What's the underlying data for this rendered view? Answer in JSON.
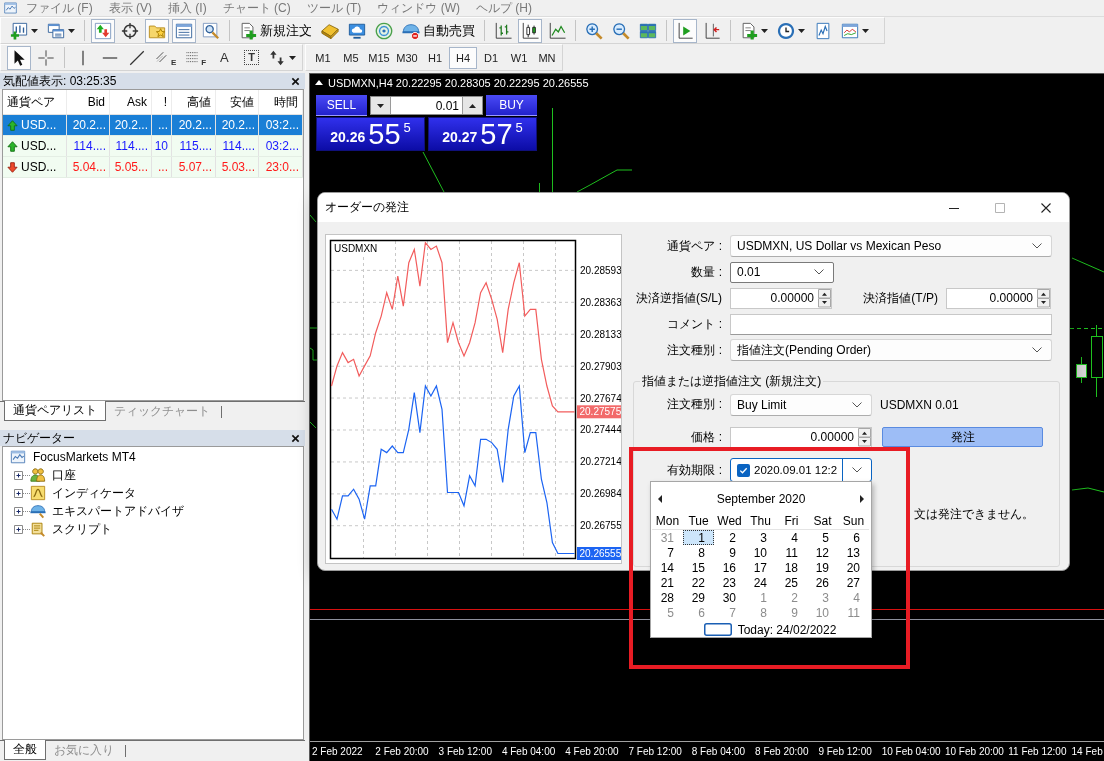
{
  "menu_bar": {
    "items": [
      "ファイル (F)",
      "表示 (V)",
      "挿入 (I)",
      "チャート (C)",
      "ツール (T)",
      "ウィンドウ (W)",
      "ヘルプ (H)"
    ]
  },
  "standard_toolbar": {
    "groups": [
      [
        {
          "kind": "new-chart",
          "pressed": false,
          "dropdown": true
        },
        {
          "kind": "profiles",
          "pressed": false,
          "dropdown": true
        }
      ],
      [
        {
          "kind": "market-watch",
          "pressed": true,
          "dropdown": false
        },
        {
          "kind": "data-window",
          "pressed": false,
          "dropdown": false
        },
        {
          "kind": "navigator",
          "pressed": true,
          "dropdown": false
        },
        {
          "kind": "terminal",
          "pressed": true,
          "dropdown": false
        },
        {
          "kind": "tester",
          "pressed": false,
          "dropdown": false
        }
      ],
      [
        {
          "kind": "new-order",
          "label": "新規注文",
          "pressed": false,
          "dropdown": false
        },
        {
          "kind": "editor",
          "pressed": false,
          "dropdown": false
        },
        {
          "kind": "cloud",
          "pressed": false,
          "dropdown": false
        },
        {
          "kind": "signals",
          "pressed": false,
          "dropdown": false
        },
        {
          "kind": "auto-trading",
          "label": "自動売買",
          "pressed": false,
          "dropdown": false
        }
      ],
      [
        {
          "kind": "bar-chart",
          "pressed": false,
          "dropdown": false
        },
        {
          "kind": "candle-chart",
          "pressed": true,
          "dropdown": false
        },
        {
          "kind": "line-chart",
          "pressed": false,
          "dropdown": false
        }
      ],
      [
        {
          "kind": "zoom-in",
          "pressed": false,
          "dropdown": false
        },
        {
          "kind": "zoom-out",
          "pressed": false,
          "dropdown": false
        },
        {
          "kind": "tile-windows",
          "pressed": false,
          "dropdown": false
        }
      ],
      [
        {
          "kind": "auto-scroll",
          "pressed": true,
          "dropdown": false
        },
        {
          "kind": "chart-shift",
          "pressed": false,
          "dropdown": false
        }
      ],
      [
        {
          "kind": "indicators",
          "pressed": false,
          "dropdown": true
        },
        {
          "kind": "periods",
          "pressed": false,
          "dropdown": true
        },
        {
          "kind": "templates",
          "pressed": false,
          "dropdown": false
        },
        {
          "kind": "template-list",
          "pressed": false,
          "dropdown": true
        }
      ]
    ]
  },
  "drawing_toolbar": {
    "groups": [
      [
        {
          "kind": "cursor",
          "pressed": true,
          "dropdown": false
        },
        {
          "kind": "crosshair",
          "pressed": false,
          "dropdown": false
        }
      ],
      [
        {
          "kind": "vertical-line",
          "pressed": false,
          "dropdown": false
        },
        {
          "kind": "horizontal-line",
          "pressed": false,
          "dropdown": false
        },
        {
          "kind": "trend-line",
          "pressed": false,
          "dropdown": false
        },
        {
          "kind": "channel",
          "glyph": "E",
          "pressed": false,
          "dropdown": false
        },
        {
          "kind": "fibonacci",
          "glyph": "F",
          "pressed": false,
          "dropdown": false
        },
        {
          "kind": "text",
          "glyph": "A",
          "pressed": false,
          "dropdown": false
        },
        {
          "kind": "text-label",
          "glyph": "T",
          "pressed": false,
          "dropdown": false
        },
        {
          "kind": "arrows",
          "pressed": false,
          "dropdown": true
        }
      ]
    ]
  },
  "timeframes": [
    {
      "label": "M1",
      "selected": false
    },
    {
      "label": "M5",
      "selected": false
    },
    {
      "label": "M15",
      "selected": false
    },
    {
      "label": "M30",
      "selected": false
    },
    {
      "label": "H1",
      "selected": false
    },
    {
      "label": "H4",
      "selected": true
    },
    {
      "label": "D1",
      "selected": false
    },
    {
      "label": "W1",
      "selected": false
    },
    {
      "label": "MN",
      "selected": false
    }
  ],
  "market_watch": {
    "title": "気配値表示: 03:25:35",
    "columns": [
      "通貨ペア",
      "Bid",
      "Ask",
      "!",
      "高値",
      "安値",
      "時間"
    ],
    "rows": [
      {
        "kind": "up",
        "selected": true,
        "cells": [
          "USD...",
          "20.2...",
          "20.2...",
          "...",
          "20.2...",
          "20.2...",
          "03:2..."
        ]
      },
      {
        "kind": "up",
        "selected": false,
        "cells": [
          "USD...",
          "114....",
          "114....",
          "10",
          "115....",
          "114....",
          "03:2..."
        ]
      },
      {
        "kind": "down",
        "selected": false,
        "cells": [
          "USD...",
          "5.04...",
          "5.05...",
          "...",
          "5.07...",
          "5.03...",
          "23:0..."
        ]
      }
    ],
    "tabs": [
      {
        "label": "通貨ペアリスト",
        "selected": true
      },
      {
        "label": "ティックチャート",
        "selected": false
      }
    ]
  },
  "navigator": {
    "title": "ナビゲーター",
    "root": {
      "label": "FocusMarkets MT4",
      "children": [
        {
          "kind": "accounts",
          "label": "口座",
          "expanded": false
        },
        {
          "kind": "indicators",
          "label": "インディケータ",
          "expanded": false
        },
        {
          "kind": "experts",
          "label": "エキスパートアドバイザ",
          "expanded": false
        },
        {
          "kind": "scripts",
          "label": "スクリプト",
          "expanded": false
        }
      ]
    },
    "tabs": [
      {
        "label": "全般",
        "selected": true
      },
      {
        "label": "お気に入り",
        "selected": false
      }
    ]
  },
  "chart": {
    "title": "USDMXN,H4 20.22295 20.28305 20.22295 20.26555",
    "one_click": {
      "sell": "SELL",
      "buy": "BUY",
      "lot": "0.01",
      "sell_price": [
        "20.26",
        "55",
        "5"
      ],
      "buy_price": [
        "20.27",
        "57",
        "5"
      ]
    },
    "time_axis": [
      "2 Feb 2022",
      "2 Feb 20:00",
      "3 Feb 12:00",
      "4 Feb 04:00",
      "4 Feb 20:00",
      "7 Feb 12:00",
      "8 Feb 04:00",
      "8 Feb 20:00",
      "9 Feb 12:00",
      "10 Feb 04:00",
      "10 Feb 20:00",
      "11 Feb 12:00",
      "14 Feb"
    ]
  },
  "order_dialog": {
    "title": "オーダーの発注",
    "chart": {
      "chart_data": {
        "type": "line",
        "title": "USDMXN",
        "grid": true,
        "ylim": [
          20.26519,
          20.28808
        ],
        "yticks": [
          20.28593,
          20.28363,
          20.28133,
          20.27903,
          20.27674,
          20.27444,
          20.27214,
          20.26984,
          20.26755
        ],
        "series": [
          {
            "color": "#f25c5c",
            "values": [
              20.27761,
              20.27905,
              20.28001,
              20.27929,
              20.27953,
              20.27833,
              20.27905,
              20.27977,
              20.28144,
              20.28264,
              20.28432,
              20.28312,
              20.28552,
              20.28336,
              20.28648,
              20.28744,
              20.2848,
              20.28792,
              20.28744,
              20.28768,
              20.28648,
              20.28072,
              20.28216,
              20.28072,
              20.27977,
              20.28072,
              20.28216,
              20.28432,
              20.28504,
              20.28384,
              20.2824,
              20.28001,
              20.28312,
              20.28504,
              20.28648,
              20.28264,
              20.28312,
              20.28312,
              20.27953,
              20.27761,
              20.27617,
              20.27575,
              20.27575,
              20.27575,
              20.27575
            ]
          },
          {
            "color": "#1c64f2",
            "values": [
              20.26874,
              20.26802,
              20.2697,
              20.2697,
              20.27018,
              20.26946,
              20.26802,
              20.27042,
              20.27042,
              20.27305,
              20.27281,
              20.27329,
              20.27281,
              20.27281,
              20.27449,
              20.27713,
              20.27425,
              20.27761,
              20.27689,
              20.27761,
              20.27593,
              20.26994,
              20.26994,
              20.26994,
              20.26898,
              20.27114,
              20.27042,
              20.27377,
              20.27377,
              20.27353,
              20.27305,
              20.27066,
              20.27449,
              20.27689,
              20.27761,
              20.27281,
              20.27425,
              20.27425,
              20.2709,
              20.26922,
              20.26634,
              20.26555,
              20.26555,
              20.26555,
              20.26555
            ]
          }
        ],
        "ref_lines": [
          {
            "label": "20.27575",
            "color": "#f26a6a"
          },
          {
            "label": "20.26555",
            "color": "#1c64f2"
          }
        ]
      }
    },
    "symbol": {
      "label": "通貨ペア :",
      "value": "USDMXN, US Dollar vs Mexican Peso"
    },
    "volume": {
      "label": "数量 :",
      "value": "0.01"
    },
    "stop_loss": {
      "label": "決済逆指値(S/L)",
      "value": "0.00000"
    },
    "take_profit": {
      "label": "決済指値(T/P)",
      "value": "0.00000"
    },
    "comment": {
      "label": "コメント :"
    },
    "order_type": {
      "label": "注文種別 :",
      "value": "指値注文(Pending Order)"
    },
    "pending": {
      "title": "指値または逆指値注文 (新規注文)",
      "type": {
        "label": "注文種別 :",
        "value": "Buy Limit"
      },
      "summary": "USDMXN 0.01",
      "price": {
        "label": "価格 :",
        "value": "0.00000"
      },
      "place_button": "発注",
      "expiry": {
        "label": "有効期限 :",
        "checked": true,
        "value": "2020.09.01 12:2"
      },
      "note": "文は発注できません。"
    },
    "calendar_popup": {
      "month": "September 2020",
      "weekdays": [
        "Mon",
        "Tue",
        "Wed",
        "Thu",
        "Fri",
        "Sat",
        "Sun"
      ],
      "weeks": [
        [
          {
            "day": "31",
            "other_month": true,
            "selected": false
          },
          {
            "day": "1",
            "other_month": false,
            "selected": true
          },
          {
            "day": "2",
            "other_month": false,
            "selected": false
          },
          {
            "day": "3",
            "other_month": false,
            "selected": false
          },
          {
            "day": "4",
            "other_month": false,
            "selected": false
          },
          {
            "day": "5",
            "other_month": false,
            "selected": false
          },
          {
            "day": "6",
            "other_month": false,
            "selected": false
          }
        ],
        [
          {
            "day": "7",
            "other_month": false,
            "selected": false
          },
          {
            "day": "8",
            "other_month": false,
            "selected": false
          },
          {
            "day": "9",
            "other_month": false,
            "selected": false
          },
          {
            "day": "10",
            "other_month": false,
            "selected": false
          },
          {
            "day": "11",
            "other_month": false,
            "selected": false
          },
          {
            "day": "12",
            "other_month": false,
            "selected": false
          },
          {
            "day": "13",
            "other_month": false,
            "selected": false
          }
        ],
        [
          {
            "day": "14",
            "other_month": false,
            "selected": false
          },
          {
            "day": "15",
            "other_month": false,
            "selected": false
          },
          {
            "day": "16",
            "other_month": false,
            "selected": false
          },
          {
            "day": "17",
            "other_month": false,
            "selected": false
          },
          {
            "day": "18",
            "other_month": false,
            "selected": false
          },
          {
            "day": "19",
            "other_month": false,
            "selected": false
          },
          {
            "day": "20",
            "other_month": false,
            "selected": false
          }
        ],
        [
          {
            "day": "21",
            "other_month": false,
            "selected": false
          },
          {
            "day": "22",
            "other_month": false,
            "selected": false
          },
          {
            "day": "23",
            "other_month": false,
            "selected": false
          },
          {
            "day": "24",
            "other_month": false,
            "selected": false
          },
          {
            "day": "25",
            "other_month": false,
            "selected": false
          },
          {
            "day": "26",
            "other_month": false,
            "selected": false
          },
          {
            "day": "27",
            "other_month": false,
            "selected": false
          }
        ],
        [
          {
            "day": "28",
            "other_month": false,
            "selected": false
          },
          {
            "day": "29",
            "other_month": false,
            "selected": false
          },
          {
            "day": "30",
            "other_month": false,
            "selected": false
          },
          {
            "day": "1",
            "other_month": true,
            "selected": false
          },
          {
            "day": "2",
            "other_month": true,
            "selected": false
          },
          {
            "day": "3",
            "other_month": true,
            "selected": false
          },
          {
            "day": "4",
            "other_month": true,
            "selected": false
          }
        ],
        [
          {
            "day": "5",
            "other_month": true,
            "selected": false
          },
          {
            "day": "6",
            "other_month": true,
            "selected": false
          },
          {
            "day": "7",
            "other_month": true,
            "selected": false
          },
          {
            "day": "8",
            "other_month": true,
            "selected": false
          },
          {
            "day": "9",
            "other_month": true,
            "selected": false
          },
          {
            "day": "10",
            "other_month": true,
            "selected": false
          },
          {
            "day": "11",
            "other_month": true,
            "selected": false
          }
        ]
      ],
      "today": "Today: 24/02/2022"
    }
  },
  "highlight_frame": true
}
